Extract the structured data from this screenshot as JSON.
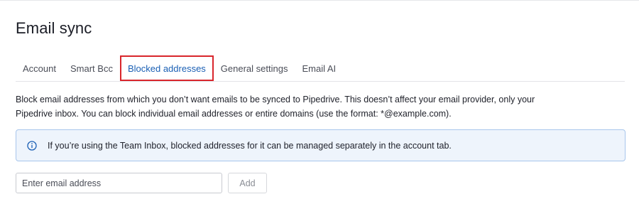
{
  "page": {
    "title": "Email sync"
  },
  "tabs": [
    {
      "label": "Account",
      "active": false
    },
    {
      "label": "Smart Bcc",
      "active": false
    },
    {
      "label": "Blocked addresses",
      "active": true
    },
    {
      "label": "General settings",
      "active": false
    },
    {
      "label": "Email AI",
      "active": false
    }
  ],
  "description": {
    "line1": "Block email addresses from which you don’t want emails to be synced to Pipedrive. This doesn’t affect your email provider, only your",
    "line2": "Pipedrive inbox. You can block individual email addresses or entire domains (use the format: *@example.com)."
  },
  "info_box": {
    "icon": "info-icon",
    "text": "If you’re using the Team Inbox, blocked addresses for it can be managed separately in the account tab."
  },
  "email_form": {
    "placeholder": "Enter email address",
    "value": "",
    "add_label": "Add"
  },
  "colors": {
    "active_tab": "#1a5fb4",
    "highlight_border": "#d9262c",
    "info_background": "#eef4fc",
    "info_border": "#a8c6ec"
  }
}
